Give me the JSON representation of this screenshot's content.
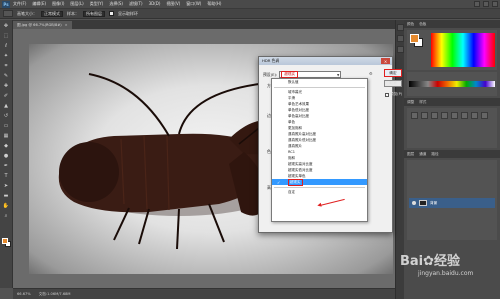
{
  "app": {
    "logo": "Ps"
  },
  "menu": [
    "文件(F)",
    "编辑(E)",
    "图像(I)",
    "图层(L)",
    "类型(Y)",
    "选择(S)",
    "滤镜(T)",
    "3D(D)",
    "视图(V)",
    "窗口(W)",
    "帮助(H)"
  ],
  "options": {
    "size_label": "画笔大小：",
    "mode_field": "正常模式",
    "sample_label": "样本：",
    "sample_field": "所有图层",
    "show_ring": "显示取样环"
  },
  "document": {
    "tab_title": "图.jpg @ 66.7%(RGB/8#)",
    "zoom": "66.67%",
    "doc_info": "文档:1.06M/7.68M"
  },
  "panels": {
    "color_tabs": [
      "颜色",
      "色板"
    ],
    "adjust_tabs": [
      "调整",
      "样式"
    ],
    "layers_tabs": [
      "图层",
      "通道",
      "路径"
    ],
    "layer_name": "背景"
  },
  "dialog": {
    "title": "HDR 色调",
    "preset_label": "预设(E):",
    "preset_value": "超现实",
    "method_label": "方",
    "side_labels": [
      "边",
      "色",
      "高"
    ],
    "ok": "确定",
    "cancel": "取消",
    "preview": "预览(P)",
    "preview_checked": "✓",
    "dropdown_items": [
      {
        "label": "默认值",
        "sep": false,
        "selected": false
      },
      {
        "label": "",
        "sep": true,
        "selected": false
      },
      {
        "label": "城市暮光",
        "sep": false,
        "selected": false
      },
      {
        "label": "平滑",
        "sep": false,
        "selected": false
      },
      {
        "label": "单色艺术效果",
        "sep": false,
        "selected": false
      },
      {
        "label": "单色低对比度",
        "sep": false,
        "selected": false
      },
      {
        "label": "单色高对比度",
        "sep": false,
        "selected": false
      },
      {
        "label": "单色",
        "sep": false,
        "selected": false
      },
      {
        "label": "更加饱和",
        "sep": false,
        "selected": false
      },
      {
        "label": "逼真照片高对比度",
        "sep": false,
        "selected": false
      },
      {
        "label": "逼真照片低对比度",
        "sep": false,
        "selected": false
      },
      {
        "label": "逼真照片",
        "sep": false,
        "selected": false
      },
      {
        "label": "RC1",
        "sep": false,
        "selected": false
      },
      {
        "label": "饱和",
        "sep": false,
        "selected": false
      },
      {
        "label": "超现实高对比度",
        "sep": false,
        "selected": false
      },
      {
        "label": "超现实低对比度",
        "sep": false,
        "selected": false
      },
      {
        "label": "超现实单色",
        "sep": false,
        "selected": false
      },
      {
        "label": "超现实",
        "sep": false,
        "selected": true
      },
      {
        "label": "",
        "sep": true,
        "selected": false
      },
      {
        "label": "自定",
        "sep": false,
        "selected": false
      }
    ]
  },
  "watermark": {
    "brand": "Bai",
    "brand2": "经验",
    "url": "jingyan.baidu.com"
  }
}
